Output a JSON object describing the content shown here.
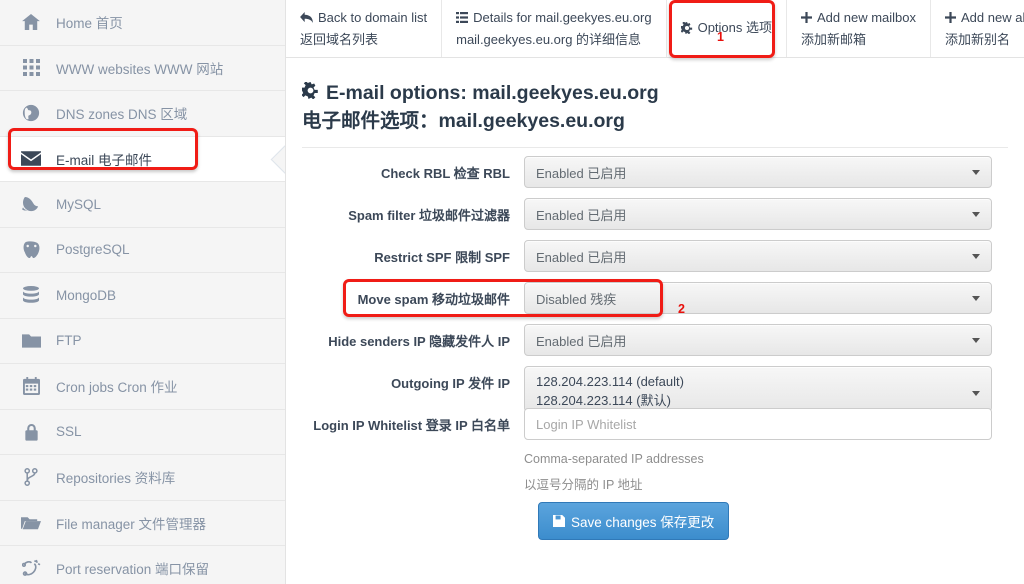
{
  "sidebar": {
    "items": [
      {
        "icon": "home-icon",
        "label": "Home 首页",
        "active": false
      },
      {
        "icon": "grid-icon",
        "label": "WWW websites WWW 网站",
        "active": false
      },
      {
        "icon": "globe-icon",
        "label": "DNS zones DNS 区域",
        "active": false
      },
      {
        "icon": "envelope-icon",
        "label": "E-mail 电子邮件",
        "active": true
      },
      {
        "icon": "dolphin-icon",
        "label": "MySQL",
        "active": false
      },
      {
        "icon": "elephant-icon",
        "label": "PostgreSQL",
        "active": false
      },
      {
        "icon": "database-icon",
        "label": "MongoDB",
        "active": false
      },
      {
        "icon": "folder-icon",
        "label": "FTP",
        "active": false
      },
      {
        "icon": "calendar-icon",
        "label": "Cron jobs Cron 作业",
        "active": false
      },
      {
        "icon": "lock-icon",
        "label": "SSL",
        "active": false
      },
      {
        "icon": "code-branch-icon",
        "label": "Repositories 资料库",
        "active": false
      },
      {
        "icon": "folder-open-icon",
        "label": "File manager 文件管理器",
        "active": false
      },
      {
        "icon": "port-reservation-icon",
        "label": "Port reservation 端口保留",
        "active": false
      }
    ]
  },
  "tabs": [
    {
      "icon": "back-arrow-icon",
      "label_en": "Back to domain list",
      "label_zh": "返回域名列表"
    },
    {
      "icon": "list-icon",
      "label_en": "Details for mail.geekyes.eu.org",
      "label_zh": "mail.geekyes.eu.org 的详细信息"
    },
    {
      "icon": "gear-icon",
      "label_en": "Options 选项",
      "label_zh": ""
    },
    {
      "icon": "plus-icon",
      "label_en": "Add new mailbox",
      "label_zh": "添加新邮箱"
    },
    {
      "icon": "plus-icon",
      "label_en": "Add new alias",
      "label_zh": "添加新别名"
    }
  ],
  "heading": {
    "icon": "gear-icon",
    "title_en": "E-mail options: mail.geekyes.eu.org",
    "title_zh": "电子邮件选项：mail.geekyes.eu.org"
  },
  "form": {
    "rows": [
      {
        "label": "Check RBL 检查 RBL",
        "value": "Enabled 已启用"
      },
      {
        "label": "Spam filter 垃圾邮件过滤器",
        "value": "Enabled 已启用"
      },
      {
        "label": "Restrict SPF 限制 SPF",
        "value": "Enabled 已启用"
      },
      {
        "label": "Move spam 移动垃圾邮件",
        "value": "Disabled 残疾"
      },
      {
        "label": "Hide senders IP 隐藏发件人 IP",
        "value": "Enabled 已启用"
      }
    ],
    "outgoing_ip": {
      "label": "Outgoing IP 发件 IP",
      "value_en": "128.204.223.114 (default)",
      "value_zh": "128.204.223.114 (默认)"
    },
    "login_ip": {
      "label": "Login IP Whitelist 登录 IP 白名单",
      "value": "",
      "placeholder": "Login IP Whitelist",
      "help_en": "Comma-separated IP addresses",
      "help_zh": "以逗号分隔的 IP 地址"
    },
    "save": {
      "icon": "save-icon",
      "label": "Save changes 保存更改"
    }
  },
  "annotations": {
    "marker1": "1",
    "marker2": "2",
    "highlight_color": "#f01c16"
  }
}
